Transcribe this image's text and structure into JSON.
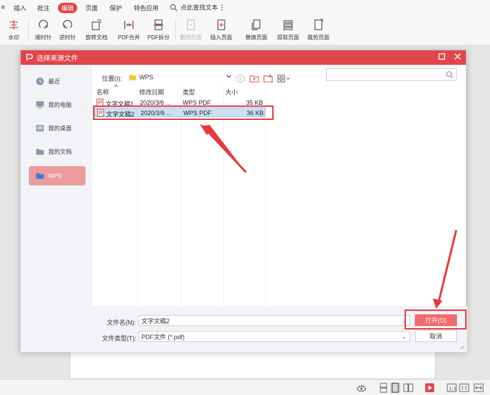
{
  "menubar": {
    "items": [
      {
        "label": "插入",
        "active": false
      },
      {
        "label": "批注",
        "active": false
      },
      {
        "label": "编辑",
        "active": true
      },
      {
        "label": "页面",
        "active": false
      },
      {
        "label": "保护",
        "active": false
      },
      {
        "label": "特色应用",
        "active": false
      }
    ],
    "search_hint": "点此查找文本"
  },
  "ribbon": {
    "buttons": [
      {
        "label": "水印",
        "icon": "watermark-icon",
        "disabled": false
      },
      {
        "label": "顺时针",
        "icon": "rotate-clockwise-icon",
        "disabled": false
      },
      {
        "label": "逆时针",
        "icon": "rotate-counterclockwise-icon",
        "disabled": false
      },
      {
        "label": "旋转文档",
        "icon": "rotate-document-icon",
        "disabled": false
      },
      {
        "label": "PDF合并",
        "icon": "pdf-merge-icon",
        "disabled": false
      },
      {
        "label": "PDF拆分",
        "icon": "pdf-split-icon",
        "disabled": false
      },
      {
        "label": "删除页面",
        "icon": "delete-page-icon",
        "disabled": true
      },
      {
        "label": "插入页面",
        "icon": "insert-page-icon",
        "disabled": false
      },
      {
        "label": "替换页面",
        "icon": "replace-page-icon",
        "disabled": false
      },
      {
        "label": "提取页面",
        "icon": "extract-page-icon",
        "disabled": false
      },
      {
        "label": "裁剪页面",
        "icon": "crop-page-icon",
        "disabled": false
      }
    ]
  },
  "dialog": {
    "title": "选择来源文件",
    "sidebar": [
      {
        "label": "最近",
        "icon": "clock-icon",
        "selected": false
      },
      {
        "label": "我的电脑",
        "icon": "computer-icon",
        "selected": false
      },
      {
        "label": "我的桌面",
        "icon": "desktop-icon",
        "selected": false
      },
      {
        "label": "我的文档",
        "icon": "documents-icon",
        "selected": false
      },
      {
        "label": "WPS",
        "icon": "folder-icon",
        "selected": true
      }
    ],
    "location_label": "位置(I):",
    "location_value": "WPS",
    "columns": [
      "名称",
      "修改日期",
      "类型",
      "大小"
    ],
    "files": [
      {
        "name": "文字文稿1",
        "date": "2020/3/6 ...",
        "type": "WPS PDF",
        "size": "35 KB",
        "selected": false
      },
      {
        "name": "文字文稿2",
        "date": "2020/3/6 ...",
        "type": "WPS PDF",
        "size": "36 KB",
        "selected": true
      }
    ],
    "filename_label": "文件名(N):",
    "filename_value": "文字文稿2",
    "filetype_label": "文件类型(T):",
    "filetype_value": "PDF文件 (*.pdf)",
    "open_label": "打开(O)",
    "cancel_label": "取消"
  },
  "colors": {
    "accent": "#e0464b",
    "annotation_red": "#e8393d",
    "selection": "#cce0f4"
  }
}
